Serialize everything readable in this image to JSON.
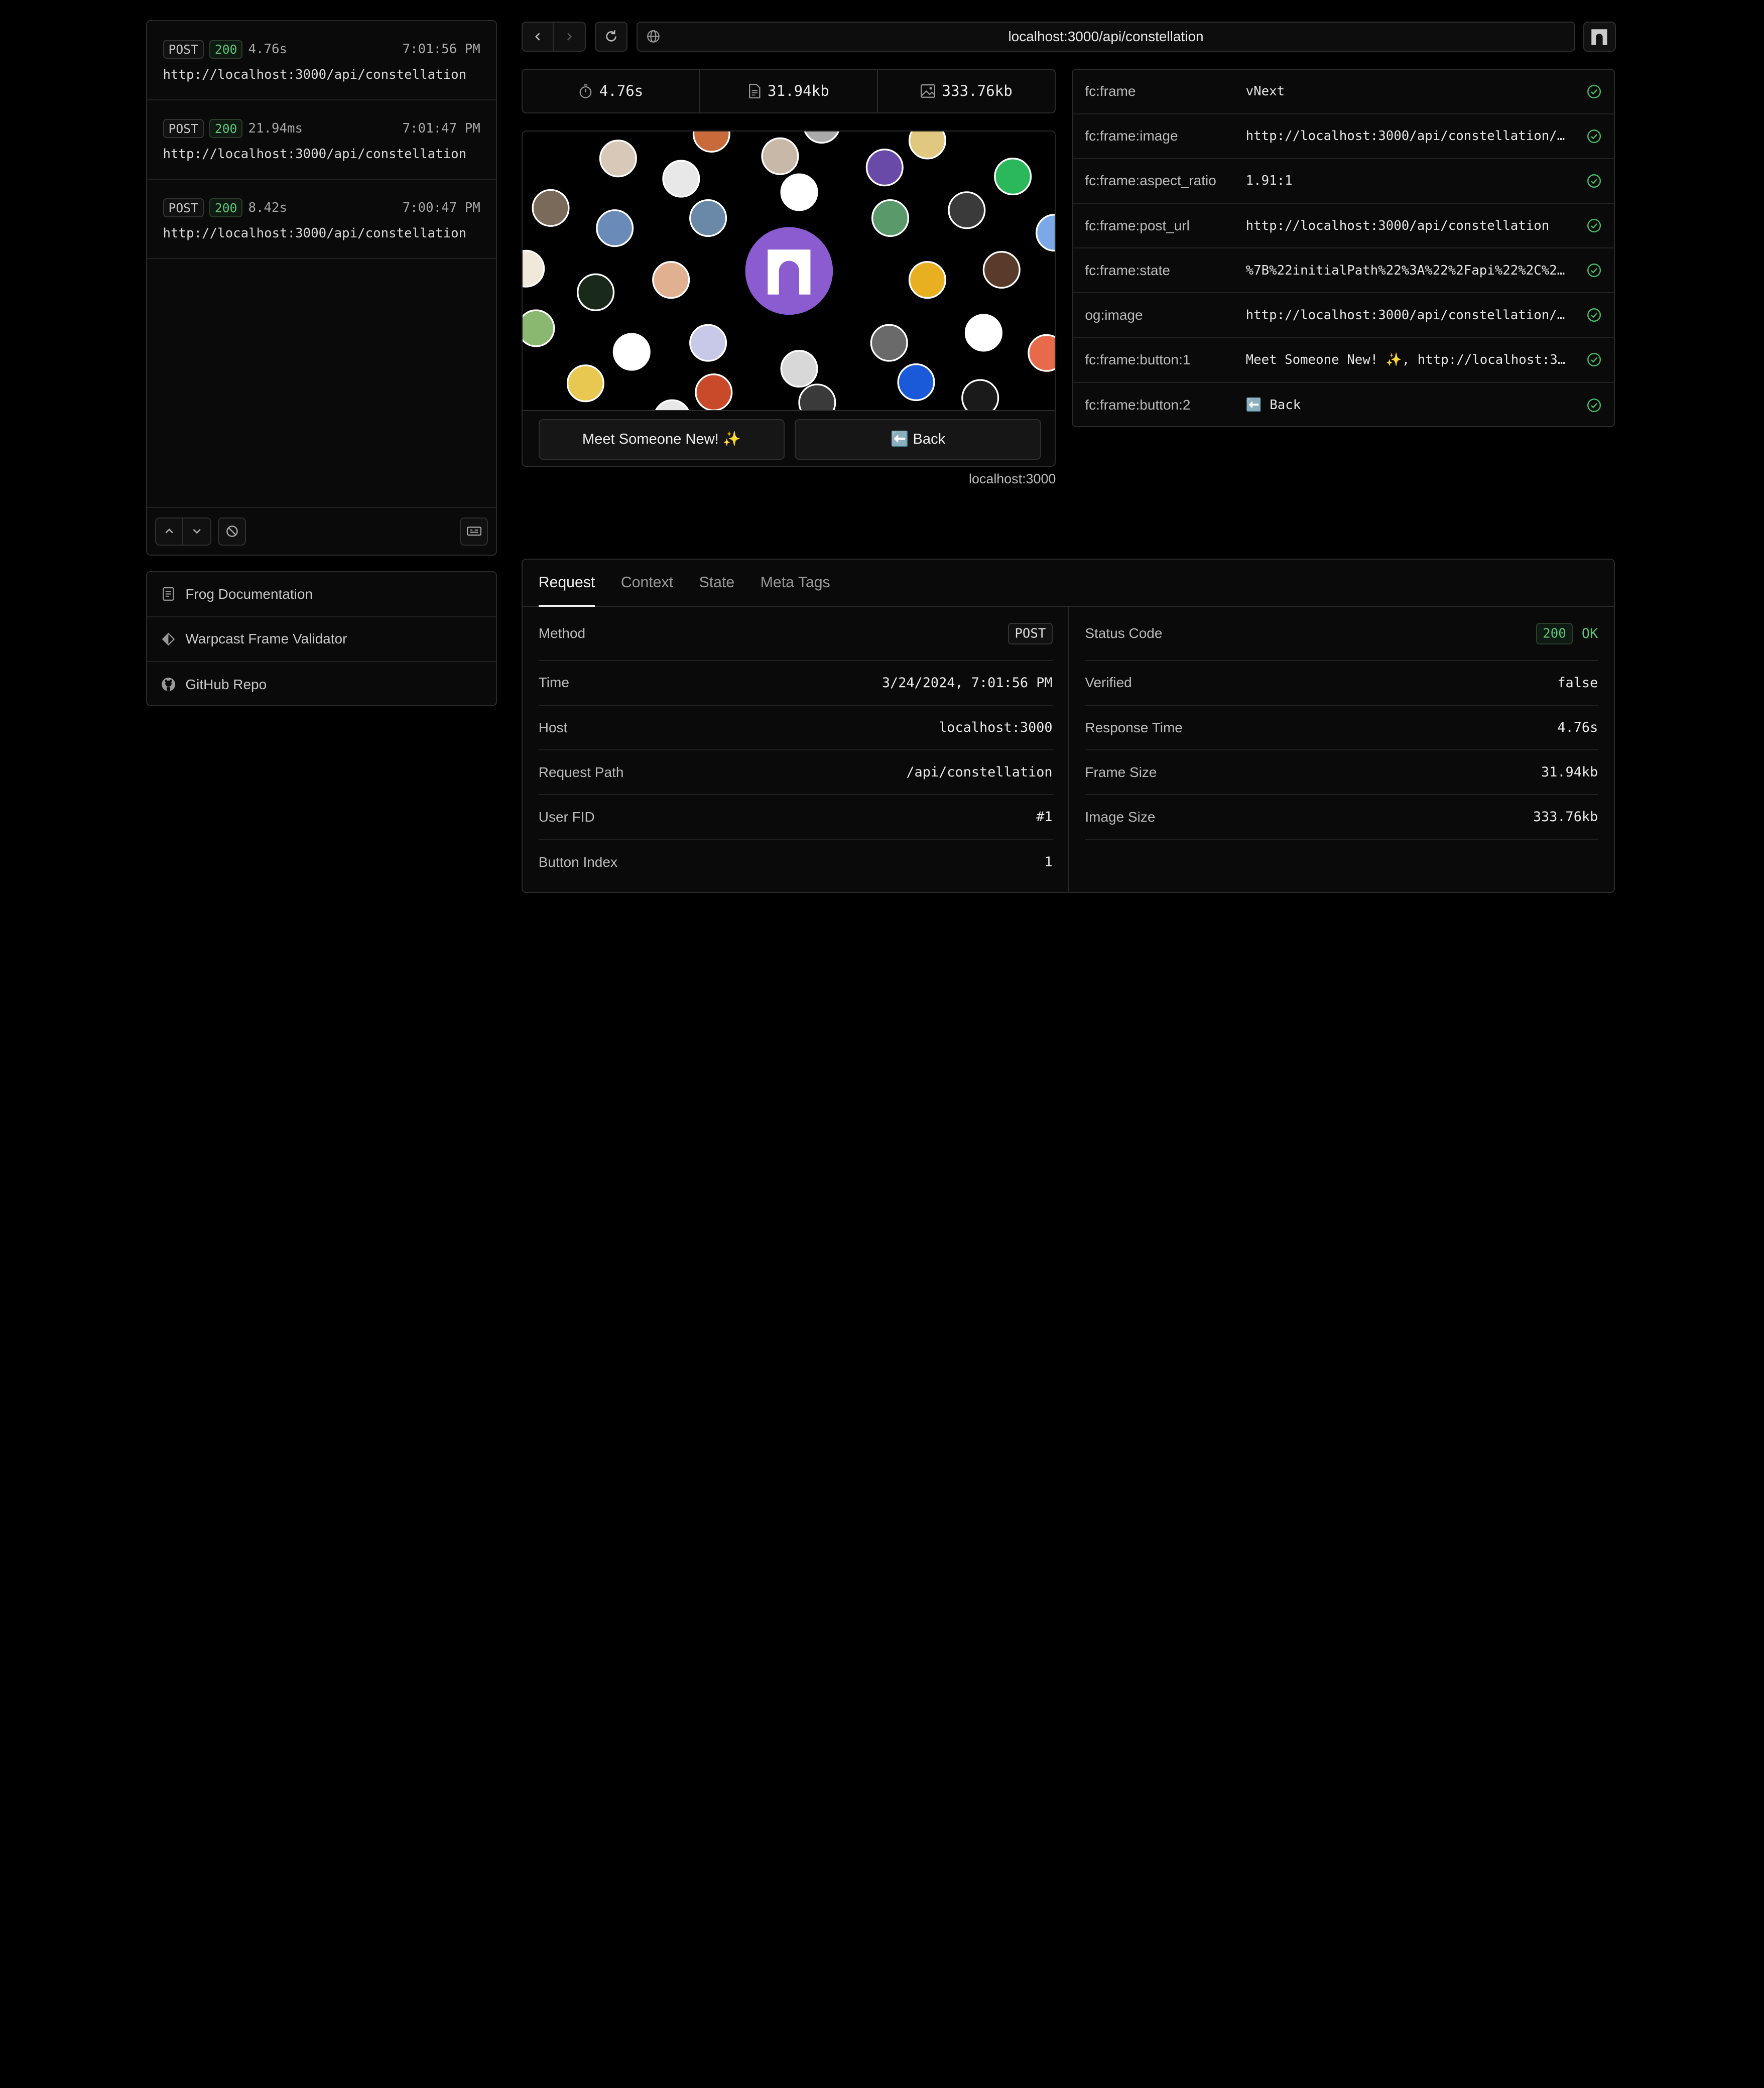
{
  "log": {
    "items": [
      {
        "method": "POST",
        "status": "200",
        "duration": "4.76s",
        "time": "7:01:56 PM",
        "url": "http://localhost:3000/api/constellation"
      },
      {
        "method": "POST",
        "status": "200",
        "duration": "21.94ms",
        "time": "7:01:47 PM",
        "url": "http://localhost:3000/api/constellation"
      },
      {
        "method": "POST",
        "status": "200",
        "duration": "8.42s",
        "time": "7:00:47 PM",
        "url": "http://localhost:3000/api/constellation"
      }
    ]
  },
  "links": [
    {
      "label": "Frog Documentation",
      "icon": "document-icon"
    },
    {
      "label": "Warpcast Frame Validator",
      "icon": "diamond-icon"
    },
    {
      "label": "GitHub Repo",
      "icon": "github-icon"
    }
  ],
  "address": {
    "url": "localhost:3000/api/constellation"
  },
  "metrics": {
    "time": "4.76s",
    "frame_size": "31.94kb",
    "image_size": "333.76kb"
  },
  "frame": {
    "buttons": [
      "Meet Someone New! ✨",
      "⬅️ Back"
    ],
    "host": "localhost:3000"
  },
  "meta_tags": [
    {
      "key": "fc:frame",
      "value": "vNext"
    },
    {
      "key": "fc:frame:image",
      "value": "http://localhost:3000/api/constellation/im…"
    },
    {
      "key": "fc:frame:aspect_ratio",
      "value": "1.91:1"
    },
    {
      "key": "fc:frame:post_url",
      "value": "http://localhost:3000/api/constellation"
    },
    {
      "key": "fc:frame:state",
      "value": "%7B%22initialPath%22%3A%22%2Fapi%22%2C%22p…"
    },
    {
      "key": "og:image",
      "value": "http://localhost:3000/api/constellation/im…"
    },
    {
      "key": "fc:frame:button:1",
      "value": "Meet Someone New! ✨, http://localhost:3000…"
    },
    {
      "key": "fc:frame:button:2",
      "value": "⬅️ Back"
    }
  ],
  "tabs": [
    "Request",
    "Context",
    "State",
    "Meta Tags"
  ],
  "request": {
    "method_label": "Method",
    "method": "POST",
    "time_label": "Time",
    "time": "3/24/2024, 7:01:56 PM",
    "host_label": "Host",
    "host": "localhost:3000",
    "path_label": "Request Path",
    "path": "/api/constellation",
    "fid_label": "User FID",
    "fid": "#1",
    "button_label": "Button Index",
    "button": "1"
  },
  "response": {
    "status_label": "Status Code",
    "status_code": "200",
    "status_text": "OK",
    "verified_label": "Verified",
    "verified": "false",
    "rt_label": "Response Time",
    "rt": "4.76s",
    "fs_label": "Frame Size",
    "fs": "31.94kb",
    "is_label": "Image Size",
    "is": "333.76kb"
  },
  "colors": {
    "accent_purple": "#8a5cd0",
    "ok_green": "#45b862"
  }
}
